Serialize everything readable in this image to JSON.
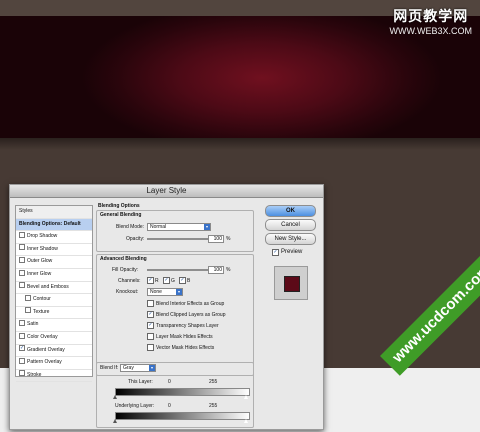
{
  "watermark_top": {
    "line1": "网页教学网",
    "line2": "WWW.WEB3X.COM"
  },
  "watermark_bottom": "www.ucdcom.com",
  "dialog": {
    "title": "Layer Style",
    "styles": {
      "header": "Styles",
      "items": [
        {
          "label": "Blending Options: Default",
          "checkbox": false,
          "checked": false,
          "selected": true
        },
        {
          "label": "Drop Shadow",
          "checkbox": true,
          "checked": false
        },
        {
          "label": "Inner Shadow",
          "checkbox": true,
          "checked": false
        },
        {
          "label": "Outer Glow",
          "checkbox": true,
          "checked": false
        },
        {
          "label": "Inner Glow",
          "checkbox": true,
          "checked": false
        },
        {
          "label": "Bevel and Emboss",
          "checkbox": true,
          "checked": false
        },
        {
          "label": "Contour",
          "checkbox": true,
          "checked": false,
          "indent": true
        },
        {
          "label": "Texture",
          "checkbox": true,
          "checked": false,
          "indent": true
        },
        {
          "label": "Satin",
          "checkbox": true,
          "checked": false
        },
        {
          "label": "Color Overlay",
          "checkbox": true,
          "checked": false
        },
        {
          "label": "Gradient Overlay",
          "checkbox": true,
          "checked": true
        },
        {
          "label": "Pattern Overlay",
          "checkbox": true,
          "checked": false
        },
        {
          "label": "Stroke",
          "checkbox": true,
          "checked": false
        }
      ]
    },
    "blending": {
      "section_title": "Blending Options",
      "general": {
        "title": "General Blending",
        "blend_mode_label": "Blend Mode:",
        "blend_mode": "Normal",
        "opacity_label": "Opacity:",
        "opacity": "100",
        "opacity_unit": "%",
        "opacity_level": 1.0
      },
      "advanced": {
        "title": "Advanced Blending",
        "fill_label": "Fill Opacity:",
        "fill": "100",
        "fill_unit": "%",
        "fill_level": 1.0,
        "channels_label": "Channels:",
        "channels": [
          "R",
          "G",
          "B"
        ],
        "knockout_label": "Knockout:",
        "knockout": "None",
        "options": [
          {
            "label": "Blend Interior Effects as Group",
            "checked": false
          },
          {
            "label": "Blend Clipped Layers as Group",
            "checked": true
          },
          {
            "label": "Transparency Shapes Layer",
            "checked": true
          },
          {
            "label": "Layer Mask Hides Effects",
            "checked": false
          },
          {
            "label": "Vector Mask Hides Effects",
            "checked": false
          }
        ]
      },
      "blend_if": {
        "label": "Blend If:",
        "value": "Gray",
        "this_layer": {
          "label": "This Layer:",
          "min": "0",
          "max": "255"
        },
        "underlying": {
          "label": "Underlying Layer:",
          "min": "0",
          "max": "255"
        }
      }
    },
    "buttons": {
      "ok": "OK",
      "cancel": "Cancel",
      "new_style": "New Style...",
      "preview": "Preview"
    },
    "preview_checked": true,
    "preview_swatch_color": "#5c0a18"
  }
}
